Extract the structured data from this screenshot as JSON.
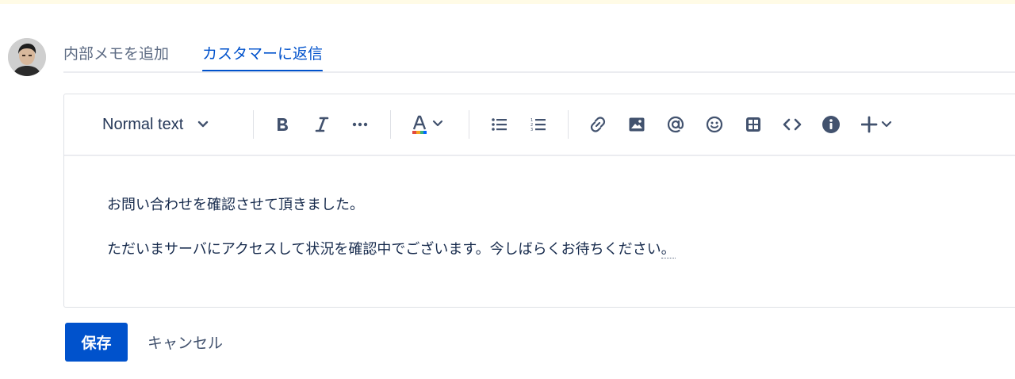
{
  "user": {
    "avatar_icon": "user-photo-avatar"
  },
  "tabs": [
    {
      "label": "内部メモを追加",
      "active": false
    },
    {
      "label": "カスタマーに返信",
      "active": true
    }
  ],
  "toolbar": {
    "text_style": "Normal text",
    "buttons": [
      "bold-icon",
      "italic-icon",
      "more-formatting-icon",
      "text-color-icon",
      "bullet-list-icon",
      "numbered-list-icon",
      "link-icon",
      "image-icon",
      "mention-icon",
      "emoji-icon",
      "table-icon",
      "code-icon",
      "info-panel-icon",
      "insert-plus-icon"
    ]
  },
  "editor": {
    "paragraph1": "お問い合わせを確認させて頂きました。",
    "paragraph2": "ただいまサーバにアクセスして状況を確認中でございます。今しばらくお待ちください",
    "paragraph2_end": "。"
  },
  "actions": {
    "save": "保存",
    "cancel": "キャンセル"
  },
  "colors": {
    "accent": "#0052cc",
    "text": "#172b4d",
    "muted": "#5e6c84",
    "top_banner": "#fffbe6"
  }
}
